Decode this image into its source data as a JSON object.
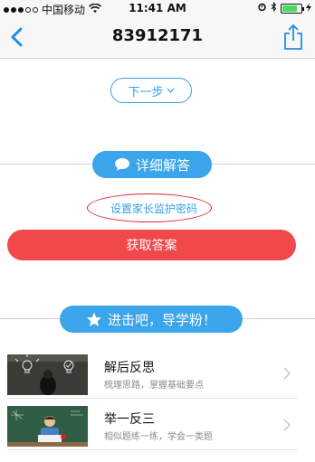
{
  "status_bar": {
    "carrier": "中国移动",
    "time": "11:41 AM",
    "battery_level": 0.8,
    "signal_bars_filled": 3
  },
  "nav": {
    "title": "83912171",
    "back_icon": "chevron-left-icon",
    "share_icon": "share-icon"
  },
  "next_step": {
    "label": "下一步"
  },
  "detail_section": {
    "label": "详细解答",
    "icon": "chat-bubble-icon"
  },
  "parent_password": {
    "label": "设置家长监护密码"
  },
  "get_answer": {
    "label": "获取答案"
  },
  "learn_section": {
    "label": "进击吧，导学粉！",
    "icon": "star-icon"
  },
  "list": [
    {
      "title": "解后反思",
      "subtitle": "梳理思路，掌握基础要点"
    },
    {
      "title": "举一反三",
      "subtitle": "相似题练一练，学会一类题"
    }
  ],
  "colors": {
    "accent": "#3aa5ea",
    "danger": "#f0484b",
    "annotation": "#e0242c"
  }
}
